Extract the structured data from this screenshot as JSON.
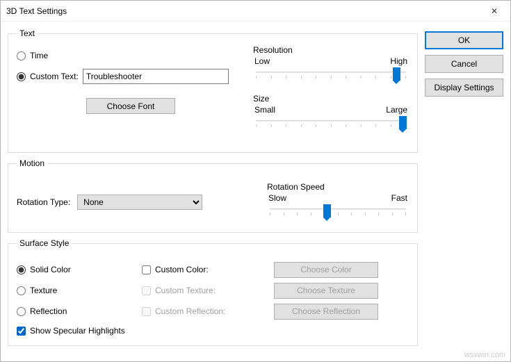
{
  "window": {
    "title": "3D Text Settings"
  },
  "buttons": {
    "ok": "OK",
    "cancel": "Cancel",
    "display_settings": "Display Settings"
  },
  "text_group": {
    "legend": "Text",
    "time_label": "Time",
    "custom_text_label": "Custom Text:",
    "custom_text_value": "Troubleshooter",
    "choose_font": "Choose Font",
    "resolution": {
      "label": "Resolution",
      "min": "Low",
      "max": "High",
      "value": 92
    },
    "size": {
      "label": "Size",
      "min": "Small",
      "max": "Large",
      "value": 96
    }
  },
  "motion_group": {
    "legend": "Motion",
    "rotation_type_label": "Rotation Type:",
    "rotation_type_value": "None",
    "rotation_speed": {
      "label": "Rotation Speed",
      "min": "Slow",
      "max": "Fast",
      "value": 42
    }
  },
  "surface_group": {
    "legend": "Surface Style",
    "solid_color": "Solid Color",
    "texture": "Texture",
    "reflection": "Reflection",
    "custom_color": "Custom Color:",
    "custom_texture": "Custom Texture:",
    "custom_reflection": "Custom Reflection:",
    "choose_color": "Choose Color",
    "choose_texture": "Choose Texture",
    "choose_reflection": "Choose Reflection",
    "show_specular": "Show Specular Highlights"
  },
  "watermark": "wsxwin.com"
}
